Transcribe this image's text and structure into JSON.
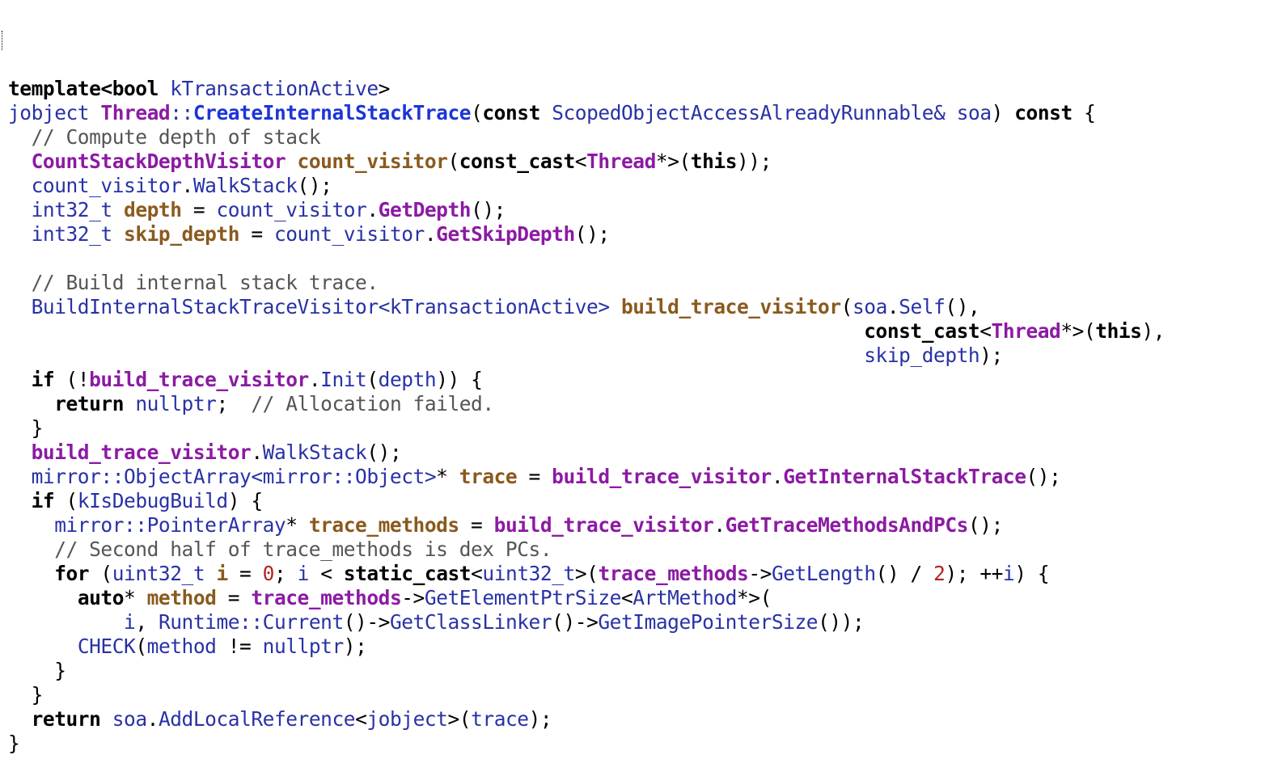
{
  "editor": {
    "language": "C++",
    "lines": [
      [
        [
          "kw",
          "template<bool"
        ],
        [
          "plain",
          " "
        ],
        [
          "type",
          "kTransactionActive"
        ],
        [
          "plain",
          ">"
        ]
      ],
      [
        [
          "type",
          "jobject"
        ],
        [
          "plain",
          " "
        ],
        [
          "cls",
          "Thread"
        ],
        [
          "type",
          "::"
        ],
        [
          "fn",
          "CreateInternalStackTrace"
        ],
        [
          "plain",
          "("
        ],
        [
          "kw",
          "const"
        ],
        [
          "plain",
          " "
        ],
        [
          "type",
          "ScopedObjectAccessAlreadyRunnable&"
        ],
        [
          "plain",
          " "
        ],
        [
          "param",
          "soa"
        ],
        [
          "plain",
          ") "
        ],
        [
          "kw",
          "const"
        ],
        [
          "plain",
          " {"
        ]
      ],
      [
        [
          "plain",
          "  "
        ],
        [
          "com",
          "// Compute depth of stack"
        ]
      ],
      [
        [
          "plain",
          "  "
        ],
        [
          "cls",
          "CountStackDepthVisitor"
        ],
        [
          "plain",
          " "
        ],
        [
          "var",
          "count_visitor"
        ],
        [
          "plain",
          "("
        ],
        [
          "kw",
          "const_cast"
        ],
        [
          "plain",
          "<"
        ],
        [
          "cls",
          "Thread"
        ],
        [
          "plain",
          "*>("
        ],
        [
          "kw",
          "this"
        ],
        [
          "plain",
          "));"
        ]
      ],
      [
        [
          "plain",
          "  "
        ],
        [
          "param",
          "count_visitor"
        ],
        [
          "plain",
          "."
        ],
        [
          "fncall",
          "WalkStack"
        ],
        [
          "plain",
          "();"
        ]
      ],
      [
        [
          "plain",
          "  "
        ],
        [
          "type",
          "int32_t"
        ],
        [
          "plain",
          " "
        ],
        [
          "var",
          "depth"
        ],
        [
          "plain",
          " = "
        ],
        [
          "param",
          "count_visitor"
        ],
        [
          "plain",
          "."
        ],
        [
          "memfn",
          "GetDepth"
        ],
        [
          "plain",
          "();"
        ]
      ],
      [
        [
          "plain",
          "  "
        ],
        [
          "type",
          "int32_t"
        ],
        [
          "plain",
          " "
        ],
        [
          "var",
          "skip_depth"
        ],
        [
          "plain",
          " = "
        ],
        [
          "param",
          "count_visitor"
        ],
        [
          "plain",
          "."
        ],
        [
          "memfn",
          "GetSkipDepth"
        ],
        [
          "plain",
          "();"
        ]
      ],
      [
        [
          "plain",
          ""
        ]
      ],
      [
        [
          "plain",
          "  "
        ],
        [
          "com",
          "// Build internal stack trace."
        ]
      ],
      [
        [
          "plain",
          "  "
        ],
        [
          "type",
          "BuildInternalStackTraceVisitor<kTransactionActive>"
        ],
        [
          "plain",
          " "
        ],
        [
          "var",
          "build_trace_visitor"
        ],
        [
          "plain",
          "("
        ],
        [
          "param",
          "soa"
        ],
        [
          "plain",
          "."
        ],
        [
          "fncall",
          "Self"
        ],
        [
          "plain",
          "(),"
        ]
      ],
      [
        [
          "plain",
          "                                                                          "
        ],
        [
          "kw",
          "const_cast"
        ],
        [
          "plain",
          "<"
        ],
        [
          "cls",
          "Thread"
        ],
        [
          "plain",
          "*>("
        ],
        [
          "kw",
          "this"
        ],
        [
          "plain",
          "),"
        ]
      ],
      [
        [
          "plain",
          "                                                                          "
        ],
        [
          "param",
          "skip_depth"
        ],
        [
          "plain",
          ");"
        ]
      ],
      [
        [
          "plain",
          "  "
        ],
        [
          "kw",
          "if"
        ],
        [
          "plain",
          " (!"
        ],
        [
          "member",
          "build_trace_visitor"
        ],
        [
          "plain",
          "."
        ],
        [
          "fncall",
          "Init"
        ],
        [
          "plain",
          "("
        ],
        [
          "param",
          "depth"
        ],
        [
          "plain",
          ")) {"
        ]
      ],
      [
        [
          "plain",
          "    "
        ],
        [
          "kw",
          "return"
        ],
        [
          "plain",
          " "
        ],
        [
          "type",
          "nullptr"
        ],
        [
          "plain",
          ";  "
        ],
        [
          "com",
          "// Allocation failed."
        ]
      ],
      [
        [
          "plain",
          "  }"
        ]
      ],
      [
        [
          "plain",
          "  "
        ],
        [
          "member",
          "build_trace_visitor"
        ],
        [
          "plain",
          "."
        ],
        [
          "fncall",
          "WalkStack"
        ],
        [
          "plain",
          "();"
        ]
      ],
      [
        [
          "plain",
          "  "
        ],
        [
          "type",
          "mirror::ObjectArray<mirror::Object>"
        ],
        [
          "plain",
          "* "
        ],
        [
          "var",
          "trace"
        ],
        [
          "plain",
          " = "
        ],
        [
          "member",
          "build_trace_visitor"
        ],
        [
          "plain",
          "."
        ],
        [
          "memfn",
          "GetInternalStackTrace"
        ],
        [
          "plain",
          "();"
        ]
      ],
      [
        [
          "plain",
          "  "
        ],
        [
          "kw",
          "if"
        ],
        [
          "plain",
          " ("
        ],
        [
          "type",
          "kIsDebugBuild"
        ],
        [
          "plain",
          ") {"
        ]
      ],
      [
        [
          "plain",
          "    "
        ],
        [
          "type",
          "mirror::PointerArray"
        ],
        [
          "plain",
          "* "
        ],
        [
          "var",
          "trace_methods"
        ],
        [
          "plain",
          " = "
        ],
        [
          "member",
          "build_trace_visitor"
        ],
        [
          "plain",
          "."
        ],
        [
          "memfn",
          "GetTraceMethodsAndPCs"
        ],
        [
          "plain",
          "();"
        ]
      ],
      [
        [
          "plain",
          "    "
        ],
        [
          "com",
          "// Second half of trace_methods is dex PCs."
        ]
      ],
      [
        [
          "plain",
          "    "
        ],
        [
          "kw",
          "for"
        ],
        [
          "plain",
          " ("
        ],
        [
          "type",
          "uint32_t"
        ],
        [
          "plain",
          " "
        ],
        [
          "var",
          "i"
        ],
        [
          "plain",
          " = "
        ],
        [
          "num",
          "0"
        ],
        [
          "plain",
          "; "
        ],
        [
          "param",
          "i"
        ],
        [
          "plain",
          " < "
        ],
        [
          "kw",
          "static_cast"
        ],
        [
          "plain",
          "<"
        ],
        [
          "type",
          "uint32_t"
        ],
        [
          "plain",
          ">("
        ],
        [
          "member",
          "trace_methods"
        ],
        [
          "plain",
          "->"
        ],
        [
          "fncall",
          "GetLength"
        ],
        [
          "plain",
          "() / "
        ],
        [
          "num",
          "2"
        ],
        [
          "plain",
          "); ++"
        ],
        [
          "param",
          "i"
        ],
        [
          "plain",
          ") {"
        ]
      ],
      [
        [
          "plain",
          "      "
        ],
        [
          "kw",
          "auto"
        ],
        [
          "plain",
          "* "
        ],
        [
          "var",
          "method"
        ],
        [
          "plain",
          " = "
        ],
        [
          "member",
          "trace_methods"
        ],
        [
          "plain",
          "->"
        ],
        [
          "fncall",
          "GetElementPtrSize"
        ],
        [
          "plain",
          "<"
        ],
        [
          "type",
          "ArtMethod"
        ],
        [
          "plain",
          "*>("
        ]
      ],
      [
        [
          "plain",
          "          "
        ],
        [
          "param",
          "i"
        ],
        [
          "plain",
          ", "
        ],
        [
          "type",
          "Runtime::"
        ],
        [
          "fncall",
          "Current"
        ],
        [
          "plain",
          "()->"
        ],
        [
          "fncall",
          "GetClassLinker"
        ],
        [
          "plain",
          "()->"
        ],
        [
          "fncall",
          "GetImagePointerSize"
        ],
        [
          "plain",
          "());"
        ]
      ],
      [
        [
          "plain",
          "      "
        ],
        [
          "fncall",
          "CHECK"
        ],
        [
          "plain",
          "("
        ],
        [
          "param",
          "method"
        ],
        [
          "plain",
          " != "
        ],
        [
          "type",
          "nullptr"
        ],
        [
          "plain",
          ");"
        ]
      ],
      [
        [
          "plain",
          "    }"
        ]
      ],
      [
        [
          "plain",
          "  }"
        ]
      ],
      [
        [
          "plain",
          "  "
        ],
        [
          "kw",
          "return"
        ],
        [
          "plain",
          " "
        ],
        [
          "param",
          "soa"
        ],
        [
          "plain",
          "."
        ],
        [
          "fncall",
          "AddLocalReference"
        ],
        [
          "plain",
          "<"
        ],
        [
          "type",
          "jobject"
        ],
        [
          "plain",
          ">("
        ],
        [
          "param",
          "trace"
        ],
        [
          "plain",
          ");"
        ]
      ],
      [
        [
          "plain",
          "}"
        ]
      ]
    ]
  },
  "colors": {
    "keyword": "#000000",
    "type": "#2832a6",
    "class": "#8c1aa3",
    "function_def": "#1c35d8",
    "local_var": "#8a5a1e",
    "comment": "#555555",
    "number": "#b22222",
    "background": "#ffffff"
  }
}
